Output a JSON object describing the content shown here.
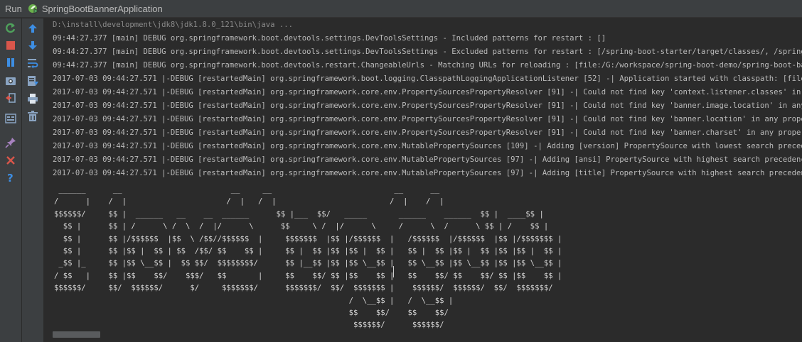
{
  "title_bar": {
    "tab_label": "Run",
    "app_name": "SpringBootBannerApplication",
    "app_icon": "spring-boot-run-icon"
  },
  "colors": {
    "background": "#2b2b2b",
    "toolbar": "#3c3f41",
    "text": "#bbbbbb",
    "rerun_green": "#4fa15c",
    "stop_red": "#d9564b",
    "accent_blue": "#3d8ee3"
  },
  "toolbar_left": [
    {
      "icon": "rerun-icon"
    },
    {
      "icon": "stop-icon"
    },
    {
      "icon": "pause-icon"
    },
    {
      "icon": "dump-threads-icon"
    },
    {
      "icon": "exit-icon"
    },
    {
      "icon": "layout-icon"
    },
    {
      "icon": "pin-icon"
    },
    {
      "icon": "close-icon"
    },
    {
      "icon": "help-icon"
    }
  ],
  "toolbar_right": [
    {
      "icon": "up-arrow-icon"
    },
    {
      "icon": "down-arrow-icon"
    },
    {
      "icon": "soft-wrap-icon"
    },
    {
      "icon": "scroll-to-end-icon"
    },
    {
      "icon": "print-icon"
    },
    {
      "icon": "clear-all-icon"
    }
  ],
  "console": {
    "command": "D:\\install\\development\\jdk8\\jdk1.8.0_121\\bin\\java ...",
    "log_lines": [
      "09:44:27.377 [main] DEBUG org.springframework.boot.devtools.settings.DevToolsSettings - Included patterns for restart : []",
      "09:44:27.377 [main] DEBUG org.springframework.boot.devtools.settings.DevToolsSettings - Excluded patterns for restart : [/spring-boot-starter/target/classes/, /spring-boot-autc",
      "09:44:27.377 [main] DEBUG org.springframework.boot.devtools.restart.ChangeableUrls - Matching URLs for reloading : [file:/G:/workspace/spring-boot-demo/spring-boot-banner/targe",
      "2017-07-03 09:44:27.571 |-DEBUG [restartedMain] org.springframework.boot.logging.ClasspathLoggingApplicationListener [52] -| Application started with classpath: [file:/G:/works",
      "2017-07-03 09:44:27.571 |-DEBUG [restartedMain] org.springframework.core.env.PropertySourcesPropertyResolver [91] -| Could not find key 'context.listener.classes' in any proper",
      "2017-07-03 09:44:27.571 |-DEBUG [restartedMain] org.springframework.core.env.PropertySourcesPropertyResolver [91] -| Could not find key 'banner.image.location' in any property",
      "2017-07-03 09:44:27.571 |-DEBUG [restartedMain] org.springframework.core.env.PropertySourcesPropertyResolver [91] -| Could not find key 'banner.location' in any property source",
      "2017-07-03 09:44:27.571 |-DEBUG [restartedMain] org.springframework.core.env.PropertySourcesPropertyResolver [91] -| Could not find key 'banner.charset' in any property source",
      "2017-07-03 09:44:27.571 |-DEBUG [restartedMain] org.springframework.core.env.MutablePropertySources [109] -| Adding [version] PropertySource with lowest search precedence",
      "2017-07-03 09:44:27.571 |-DEBUG [restartedMain] org.springframework.core.env.MutablePropertySources [97] -| Adding [ansi] PropertySource with highest search precedence",
      "2017-07-03 09:44:27.571 |-DEBUG [restartedMain] org.springframework.core.env.MutablePropertySources [97] -| Adding [title] PropertySource with highest search precedence"
    ],
    "banner": [
      " ______      __                        __     __                           __      __",
      "/      |    /  |                      /  |   /  |                         /  |    /  |",
      "$$$$$$/     $$ |  ______   __    __  ______      $$ |___  $$/   _____       ______    ______  $$ |  ____$$ |",
      "  $$ |      $$ | /      \\ /  \\  /  |/      \\      $$     \\ /  |/      \\     /      \\  /      \\ $$ | /    $$ |",
      "  $$ |      $$ |/$$$$$$  |$$  \\ /$$//$$$$$$  |     $$$$$$$  |$$ |/$$$$$$  |   /$$$$$$  |/$$$$$$  |$$ |/$$$$$$$ |",
      "  $$ |      $$ |$$ |  $$ | $$  /$$/ $$    $$ |     $$ |  $$ |$$ |$$ |  $$ |   $$ |  $$ |$$ |  $$ |$$ |$$ |  $$ |",
      " _$$ |_     $$ |$$ \\__$$ |  $$ $$/  $$$$$$$$/      $$ |__$$ |$$ |$$ \\__$$ |   $$ \\__$$ |$$ \\__$$ |$$ |$$ \\__$$ |",
      "/ $$   |    $$ |$$    $$/    $$$/   $$       |     $$    $$/ $$ |$$    $$ |   $$    $$/ $$    $$/ $$ |$$    $$ |",
      "$$$$$$/     $$/  $$$$$$/      $/     $$$$$$$/      $$$$$$$/  $$/  $$$$$$$ |    $$$$$$/  $$$$$$/  $$/  $$$$$$$/",
      "                                                                 /  \\__$$ |   /  \\__$$ |",
      "                                                                 $$    $$/    $$    $$/",
      "                                                                  $$$$$$/      $$$$$$/"
    ]
  }
}
